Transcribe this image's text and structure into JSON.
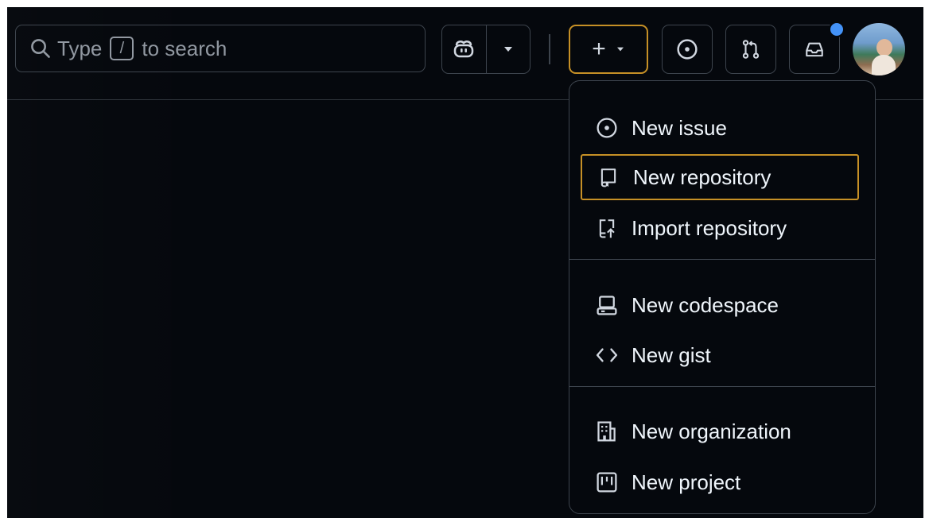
{
  "search": {
    "text_before": "Type",
    "key": "/",
    "text_after": "to search"
  },
  "header": {
    "create_plus": "+",
    "icons": [
      "search-icon",
      "copilot-icon",
      "triangle-down-icon",
      "plus-icon",
      "issue-opened-icon",
      "git-pull-request-icon",
      "inbox-icon",
      "avatar"
    ],
    "accent_color": "#c69026",
    "notification_color": "#4493f8"
  },
  "menu": {
    "items": [
      {
        "label": "New issue",
        "icon": "issue-opened-icon"
      },
      {
        "label": "New repository",
        "icon": "repo-icon"
      },
      {
        "label": "Import repository",
        "icon": "repo-push-icon"
      },
      {
        "label": "New codespace",
        "icon": "codespaces-icon"
      },
      {
        "label": "New gist",
        "icon": "code-icon"
      },
      {
        "label": "New organization",
        "icon": "organization-icon"
      },
      {
        "label": "New project",
        "icon": "project-icon"
      }
    ]
  }
}
